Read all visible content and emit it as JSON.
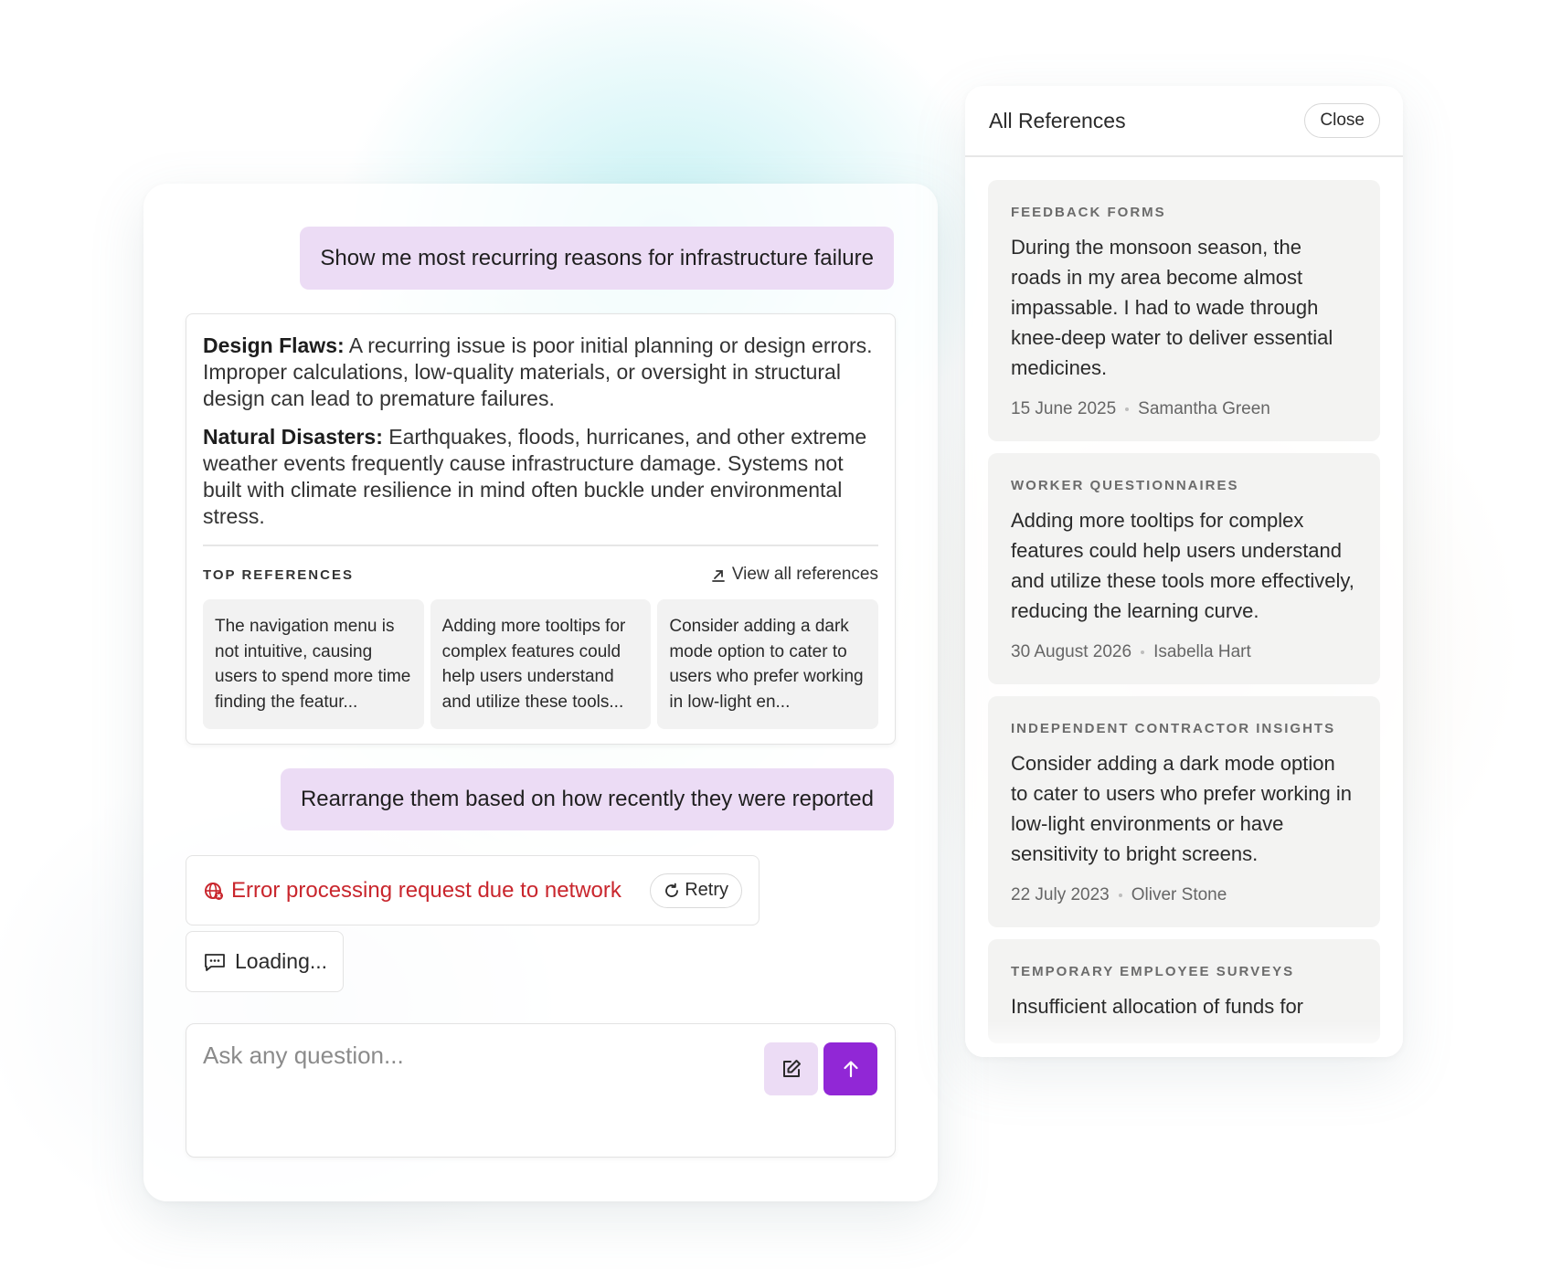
{
  "chat": {
    "user_messages": [
      "Show me most recurring reasons for infrastructure failure",
      "Rearrange them based on how recently they were reported"
    ],
    "answer": {
      "paragraphs": [
        {
          "label": "Design Flaws:",
          "text": " A recurring issue is poor initial planning or design errors. Improper calculations, low-quality materials, or oversight in structural design can lead to premature failures."
        },
        {
          "label": "Natural Disasters:",
          "text": " Earthquakes, floods, hurricanes, and other extreme weather events frequently cause infrastructure damage. Systems not built with climate resilience in mind often buckle under environmental stress."
        }
      ],
      "top_references_title": "TOP REFERENCES",
      "view_all_label": "View all references",
      "reference_tiles": [
        "The navigation menu is not intuitive, causing users to spend more time finding the featur...",
        "Adding more tooltips for complex features could help users understand and utilize these tools...",
        "Consider adding a dark mode option to cater to users who prefer working in low-light en..."
      ]
    },
    "error": {
      "message": "Error processing request due to network",
      "retry_label": "Retry",
      "color": "#c9262d"
    },
    "loading_label": "Loading...",
    "input": {
      "placeholder": "Ask any question...",
      "value": ""
    },
    "colors": {
      "accent": "#9127d6",
      "user_bubble": "#ecdcf5"
    }
  },
  "references_panel": {
    "title": "All References",
    "close_label": "Close",
    "items": [
      {
        "category": "FEEDBACK FORMS",
        "text": "During the monsoon season, the roads in my area become almost impassable. I had to wade through knee-deep water to deliver essential medicines.",
        "date": "15 June 2025",
        "author": "Samantha Green"
      },
      {
        "category": "WORKER QUESTIONNAIRES",
        "text": "Adding more tooltips for complex features could help users understand and utilize these tools more effectively, reducing the learning curve.",
        "date": "30 August 2026",
        "author": "Isabella Hart"
      },
      {
        "category": "INDEPENDENT CONTRACTOR INSIGHTS",
        "text": "Consider adding a dark mode option to cater to users who prefer working in low-light environments or have sensitivity to bright screens.",
        "date": "22 July 2023",
        "author": "Oliver Stone"
      },
      {
        "category": "TEMPORARY EMPLOYEE SURVEYS",
        "text": "Insufficient allocation of funds for",
        "date": "",
        "author": ""
      }
    ]
  }
}
